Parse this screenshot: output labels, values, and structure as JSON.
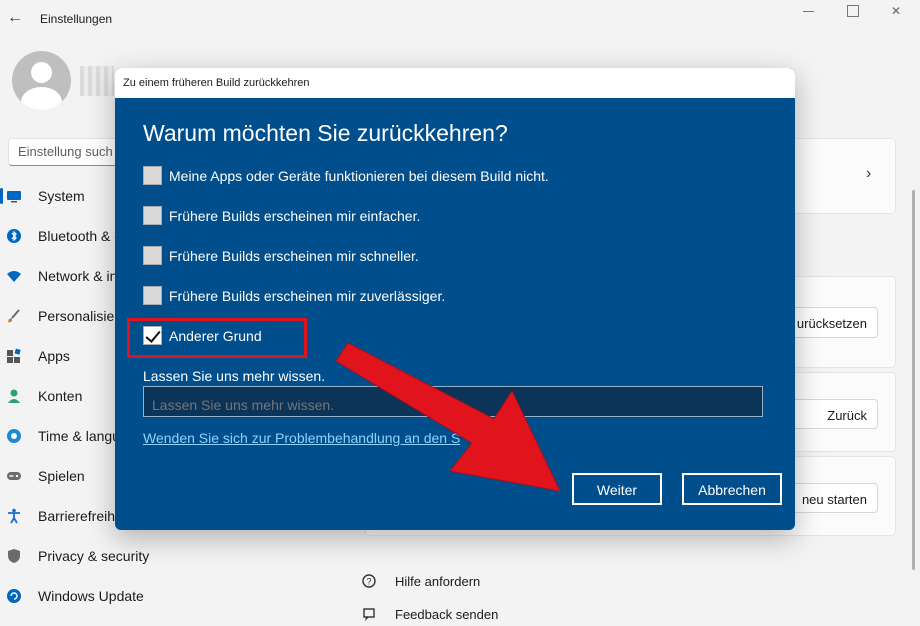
{
  "window": {
    "title": "Einstellungen",
    "search_placeholder": "Einstellung such"
  },
  "sidebar": {
    "items": [
      {
        "label": "System",
        "icon": "monitor-icon",
        "color": "#0067c0"
      },
      {
        "label": "Bluetooth & g",
        "icon": "bluetooth-icon",
        "color": "#0067c0"
      },
      {
        "label": "Network & in",
        "icon": "wifi-icon",
        "color": "#0067c0"
      },
      {
        "label": "Personalisier",
        "icon": "brush-icon",
        "color": "#c97a2e"
      },
      {
        "label": "Apps",
        "icon": "apps-icon",
        "color": "#4c4c4c"
      },
      {
        "label": "Konten",
        "icon": "account-icon",
        "color": "#2aa36d"
      },
      {
        "label": "Time & langu",
        "icon": "globe-icon",
        "color": "#1a8ad4"
      },
      {
        "label": "Spielen",
        "icon": "gamepad-icon",
        "color": "#6b6b6b"
      },
      {
        "label": "Barrierefreih",
        "icon": "accessibility-icon",
        "color": "#1a6bd4"
      },
      {
        "label": "Privacy & security",
        "icon": "shield-icon",
        "color": "#6b6b6b"
      },
      {
        "label": "Windows Update",
        "icon": "update-icon",
        "color": "#0067c0"
      }
    ]
  },
  "content": {
    "reset_button": "urücksetzen",
    "back_button": "Zurück",
    "restart_button": "neu starten",
    "help_link": "Hilfe anfordern",
    "feedback_link": "Feedback senden"
  },
  "dialog": {
    "title": "Zu einem früheren Build zurückkehren",
    "heading": "Warum möchten Sie zurückkehren?",
    "options": [
      {
        "label": "Meine Apps oder Geräte funktionieren bei diesem Build nicht.",
        "checked": false
      },
      {
        "label": "Frühere Builds erscheinen mir einfacher.",
        "checked": false
      },
      {
        "label": "Frühere Builds erscheinen mir schneller.",
        "checked": false
      },
      {
        "label": "Frühere Builds erscheinen mir zuverlässiger.",
        "checked": false
      },
      {
        "label": "Anderer Grund",
        "checked": true
      }
    ],
    "more_label": "Lassen Sie uns mehr wissen.",
    "more_placeholder": "Lassen Sie uns mehr wissen.",
    "trouble_link": "Wenden Sie sich zur Problembehandlung an den S",
    "next_button": "Weiter",
    "cancel_button": "Abbrechen",
    "background": "#004e8c"
  },
  "annotation": {
    "highlight_color": "#e1141e",
    "arrow_color": "#e1141e"
  }
}
